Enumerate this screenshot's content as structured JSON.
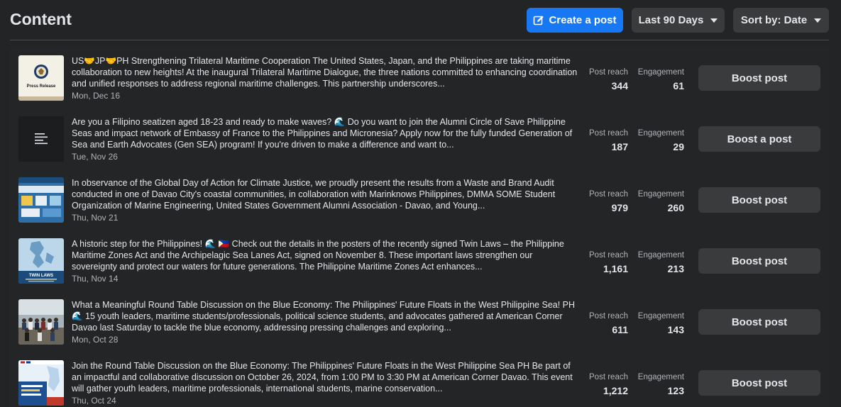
{
  "header": {
    "title": "Content",
    "create_label": "Create a post",
    "range_label": "Last 90 Days",
    "sort_label": "Sort by: Date"
  },
  "colors": {
    "accent": "#1877f2",
    "background": "#232425",
    "button": "#3a3b3c"
  },
  "metric_labels": {
    "reach": "Post reach",
    "engagement": "Engagement"
  },
  "posts": [
    {
      "thumb": "press-release",
      "text": "US🤝JP🤝PH Strengthening Trilateral Maritime Cooperation The United States, Japan, and the Philippines are taking maritime collaboration to new heights! At the inaugural Trilateral Maritime Dialogue, the three nations committed to enhancing coordination and unified responses to address regional maritime challenges. This partnership underscores...",
      "date": "Mon, Dec 16",
      "reach": "344",
      "engagement": "61",
      "boost_label": "Boost post"
    },
    {
      "thumb": "text-post",
      "text": "Are you a Filipino seatizen aged 18-23 and ready to make waves? 🌊 Do you want to join the Alumni Circle of Save Philippine Seas and impact network of Embassy of France to the Philippines and Micronesia? Apply now for the fully funded Generation of Sea and Earth Advocates (Gen SEA) program! If you're driven to make a difference and want to...",
      "date": "Tue, Nov 26",
      "reach": "187",
      "engagement": "29",
      "boost_label": "Boost a post"
    },
    {
      "thumb": "infographic",
      "text": "In observance of the Global Day of Action for Climate Justice, we proudly present the results from a Waste and Brand Audit conducted in one of Davao City's coastal communities, in collaboration with Marinknows Philippines, DMMA SOME Student Organization of Marine Engineering, United States Government Alumni Association - Davao, and Young...",
      "date": "Thu, Nov 21",
      "reach": "979",
      "engagement": "260",
      "boost_label": "Boost post"
    },
    {
      "thumb": "twin-laws",
      "text": "A historic step for the Philippines! 🌊 🇵🇭 Check out the details in the posters of the recently signed Twin Laws – the Philippine Maritime Zones Act and the Archipelagic Sea Lanes Act, signed on November 8. These important laws strengthen our sovereignty and protect our waters for future generations. The Philippine Maritime Zones Act enhances...",
      "date": "Thu, Nov 14",
      "reach": "1,161",
      "engagement": "213",
      "boost_label": "Boost post"
    },
    {
      "thumb": "group-photo",
      "text": "What a Meaningful Round Table Discussion on the Blue Economy: The Philippines' Future Floats in the West Philippine Sea! PH🌊 15 youth leaders, maritime students/professionals, political science students, and advocates gathered at American Corner Davao last Saturday to tackle the blue economy, addressing pressing challenges and exploring...",
      "date": "Mon, Oct 28",
      "reach": "611",
      "engagement": "143",
      "boost_label": "Boost post"
    },
    {
      "thumb": "event-poster",
      "text": "Join the Round Table Discussion on the Blue Economy: The Philippines' Future Floats in the West Philippine Sea PH Be part of an impactful and collaborative discussion on October 26, 2024, from 1:00 PM to 3:30 PM at American Corner Davao. This event will gather youth leaders, maritime professionals, international students, marine conservation...",
      "date": "Thu, Oct 24",
      "reach": "1,212",
      "engagement": "123",
      "boost_label": "Boost post"
    }
  ],
  "thumb_text": {
    "press_release": "Press Release",
    "twin_laws": "TWIN LAWS"
  }
}
